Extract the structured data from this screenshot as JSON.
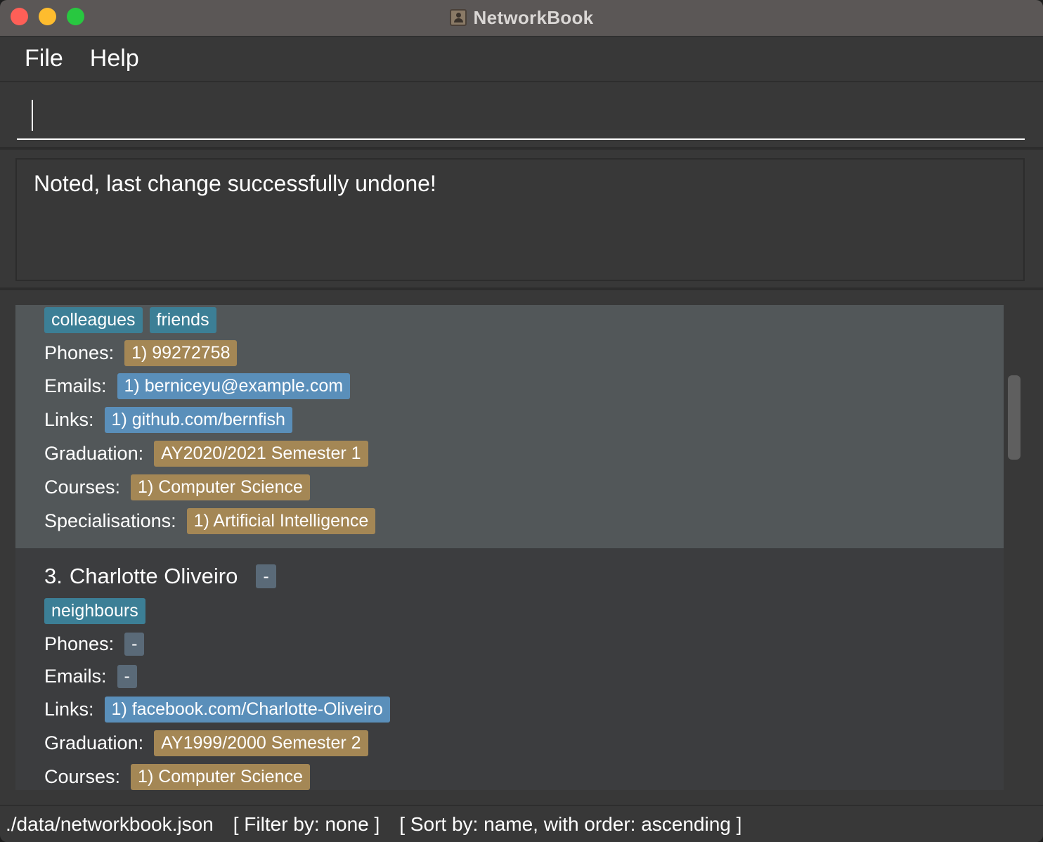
{
  "window": {
    "title": "NetworkBook",
    "icon": "contact-book-icon",
    "traffic_lights": {
      "close": "#fe5f57",
      "minimize": "#febc2e",
      "zoom": "#28c840"
    }
  },
  "menu": {
    "file": "File",
    "help": "Help"
  },
  "command": {
    "value": "",
    "placeholder": ""
  },
  "result": {
    "message": "Noted, last change successfully undone!"
  },
  "labels": {
    "phones": "Phones:",
    "emails": "Emails:",
    "links": "Links:",
    "graduation": "Graduation:",
    "courses": "Courses:",
    "specialisations": "Specialisations:",
    "empty": "-"
  },
  "contacts": [
    {
      "tags": [
        "colleagues",
        "friends"
      ],
      "phones": [
        "1) 99272758"
      ],
      "emails": [
        "1) berniceyu@example.com"
      ],
      "links": [
        "1) github.com/bernfish"
      ],
      "graduation": "AY2020/2021 Semester 1",
      "courses": [
        "1) Computer Science"
      ],
      "specialisations": [
        "1) Artificial Intelligence"
      ]
    },
    {
      "index": "3.",
      "name": "Charlotte Oliveiro",
      "name_badge": "-",
      "tags": [
        "neighbours"
      ],
      "phones": "-",
      "emails": "-",
      "links": [
        "1) facebook.com/Charlotte-Oliveiro"
      ],
      "graduation": "AY1999/2000 Semester 2",
      "courses": [
        "1) Computer Science"
      ]
    }
  ],
  "colors": {
    "tag": "#3c7f96",
    "email_link": "#5a8fba",
    "phone_grad_course": "#a48755",
    "empty_chip": "#5a6a78",
    "selected_card": "#525759"
  },
  "status": {
    "file_path": "./data/networkbook.json",
    "filter": "[ Filter by: none ]",
    "sort": "[ Sort by: name, with order: ascending ]"
  }
}
